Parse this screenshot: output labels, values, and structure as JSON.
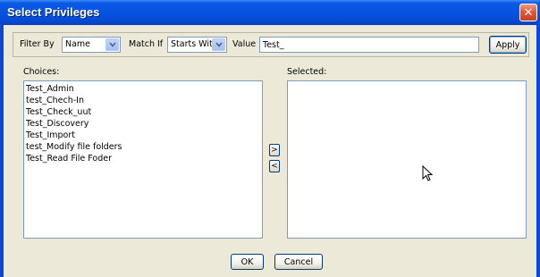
{
  "window": {
    "title": "Select Privileges",
    "close_glyph": "✕"
  },
  "filter": {
    "filter_by_label": "Filter By",
    "filter_by_value": "Name",
    "match_if_label": "Match If",
    "match_if_value": "Starts With",
    "value_label": "Value",
    "value_text": "Test_",
    "apply_label": "Apply"
  },
  "choices": {
    "label": "Choices:",
    "items": [
      "Test_Admin",
      "test_Chech-In",
      "Test_Check_uut",
      "Test_Discovery",
      "Test_Import",
      "test_Modify file folders",
      "Test_Read File Foder"
    ]
  },
  "selected": {
    "label": "Selected:",
    "items": []
  },
  "move": {
    "add_glyph": ">",
    "remove_glyph": "<"
  },
  "footer": {
    "ok_label": "OK",
    "cancel_label": "Cancel"
  },
  "colors": {
    "title_bar": "#0654e0",
    "client_bg": "#ece9d8",
    "close_button": "#e05a3a"
  },
  "icons": {
    "cursor": "mouse-pointer-icon",
    "dropdown": "chevron-down-icon"
  }
}
